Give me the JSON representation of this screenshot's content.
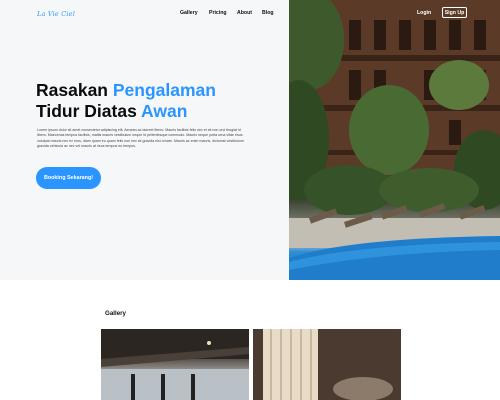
{
  "brand": {
    "logo_text": "La Vie Ciel"
  },
  "nav": {
    "items": [
      "Gallery",
      "Pricing",
      "About",
      "Blog"
    ],
    "login_label": "Login",
    "signup_label": "Sign Up"
  },
  "hero": {
    "title_line1_part1": "Rasakan ",
    "title_line1_accent": "Pengalaman",
    "title_line2_part1": "Tidur Diatas ",
    "title_line2_accent": "Awan",
    "description": "Lorem ipsum dolor sit amet consectetur adipiscing elit. Aenean ac laoreet libero. Mauris facilisis felis nec et sit non orci feugiat id libero. Maecenas tempus facilisis, mattis mauris vestibulum neque id pellentesque commodo. Mauris neque porta urna vitae risus volutpat mauris nec ex eros, diam quam eu quam felis non nec sit gravida nisl ornare. Mauris ac enim mauris, dictumst vestibulum gravida vehicula ac nec vel mauris at risus tempus eu tempus.",
    "cta_label": "Booking Sekarang!"
  },
  "gallery": {
    "title": "Gallery"
  },
  "colors": {
    "accent": "#2b95ff",
    "background": "#f6f7f9"
  }
}
